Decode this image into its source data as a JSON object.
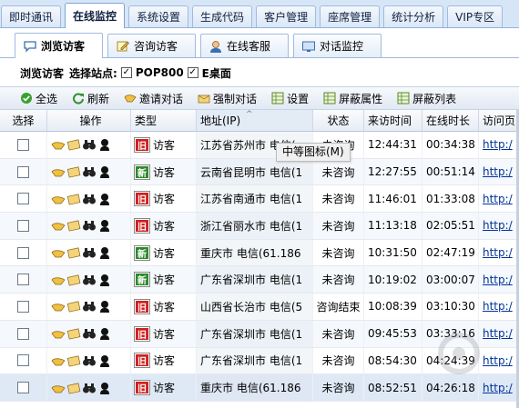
{
  "top_tabs": [
    "即时通讯",
    "在线监控",
    "系统设置",
    "生成代码",
    "客户管理",
    "座席管理",
    "统计分析",
    "VIP专区"
  ],
  "sub_tabs": [
    "浏览访客",
    "咨询访客",
    "在线客服",
    "对话监控"
  ],
  "site_bar": {
    "label1": "浏览访客",
    "label2": "选择站点:",
    "site1": "POP800",
    "site2": "E桌面"
  },
  "toolbar": [
    "全选",
    "刷新",
    "邀请对话",
    "强制对话",
    "设置",
    "屏蔽属性",
    "屏蔽列表"
  ],
  "columns": [
    "选择",
    "操作",
    "类型",
    "地址(IP)",
    "状态",
    "来访时间",
    "在线时长",
    "访问页"
  ],
  "tooltip": "中等图标(M)",
  "rows": [
    {
      "badge": "旧",
      "type": "访客",
      "addr": "江苏省苏州市 电信(",
      "state": "未咨询",
      "time": "12:44:31",
      "dur": "00:34:38",
      "page": "http:/"
    },
    {
      "badge": "新",
      "type": "访客",
      "addr": "云南省昆明市 电信(1",
      "state": "未咨询",
      "time": "12:27:55",
      "dur": "00:51:14",
      "page": "http:/"
    },
    {
      "badge": "旧",
      "type": "访客",
      "addr": "江苏省南通市 电信(1",
      "state": "未咨询",
      "time": "11:46:01",
      "dur": "01:33:08",
      "page": "http:/"
    },
    {
      "badge": "旧",
      "type": "访客",
      "addr": "浙江省丽水市 电信(1",
      "state": "未咨询",
      "time": "11:13:18",
      "dur": "02:05:51",
      "page": "http:/"
    },
    {
      "badge": "新",
      "type": "访客",
      "addr": "重庆市 电信(61.186",
      "state": "未咨询",
      "time": "10:31:50",
      "dur": "02:47:19",
      "page": "http:/"
    },
    {
      "badge": "新",
      "type": "访客",
      "addr": "广东省深圳市 电信(1",
      "state": "未咨询",
      "time": "10:19:02",
      "dur": "03:00:07",
      "page": "http:/"
    },
    {
      "badge": "旧",
      "type": "访客",
      "addr": "山西省长治市 电信(5",
      "state": "咨询结束",
      "time": "10:08:39",
      "dur": "03:10:30",
      "page": "http:/"
    },
    {
      "badge": "旧",
      "type": "访客",
      "addr": "广东省深圳市 电信(1",
      "state": "未咨询",
      "time": "09:45:53",
      "dur": "03:33:16",
      "page": "http:/"
    },
    {
      "badge": "旧",
      "type": "访客",
      "addr": "广东省深圳市 电信(1",
      "state": "未咨询",
      "time": "08:54:30",
      "dur": "04:24:39",
      "page": "http:/"
    },
    {
      "badge": "旧",
      "type": "访客",
      "addr": "重庆市 电信(61.186",
      "state": "未咨询",
      "time": "08:52:51",
      "dur": "04:26:18",
      "page": "http:/"
    }
  ],
  "watermark": "当下软件园 www.downxia.com"
}
